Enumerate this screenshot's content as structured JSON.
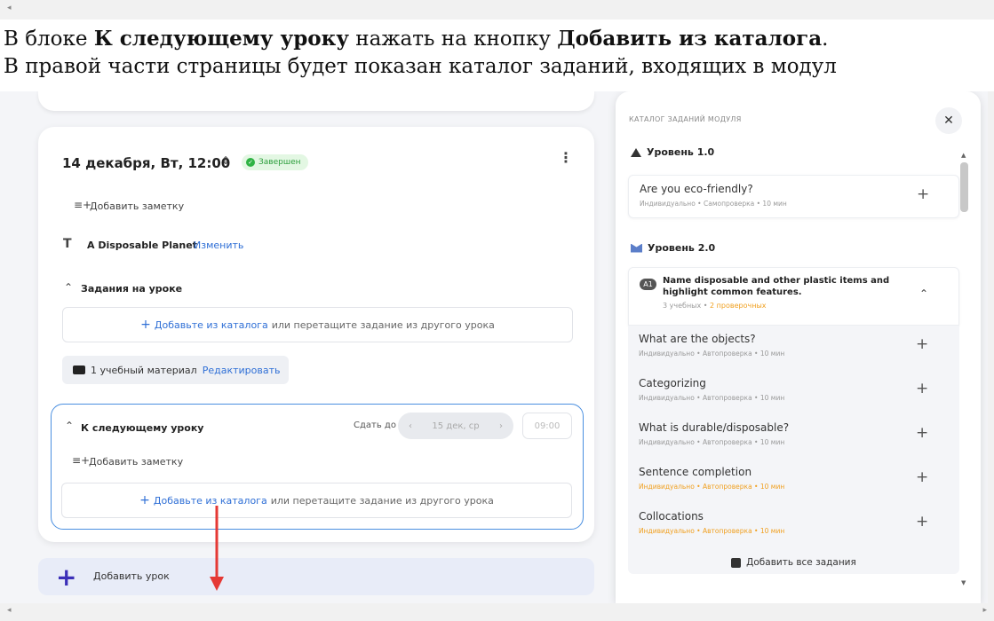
{
  "instructions": {
    "line1_a": "В блоке ",
    "line1_b": "К следующему уроку",
    "line1_c": " нажать на кнопку ",
    "line1_d": "Добавить из каталога",
    "line1_e": ".",
    "line2": "В правой части страницы будет показан каталог заданий, входящих в модул"
  },
  "lesson": {
    "date": "14 декабря, Вт, 12:00",
    "status": "Завершен",
    "add_note": "Добавить заметку",
    "topic_title": "A Disposable Planet",
    "topic_edit": "Изменить",
    "tasks_header": "Задания на уроке",
    "drop_link": "Добавьте из каталога",
    "drop_rest": "или перетащите задание из другого урока",
    "material": "1 учебный материал",
    "material_edit": "Редактировать"
  },
  "next_lesson": {
    "header": "К следующему уроку",
    "due_label": "Сдать до",
    "due_date": "15 дек, ср",
    "due_time": "09:00",
    "add_note": "Добавить заметку",
    "drop_link": "Добавьте из каталога",
    "drop_rest": "или перетащите задание из другого урока"
  },
  "add_lesson": {
    "label": "Добавить урок"
  },
  "catalog": {
    "title": "КАТАЛОГ ЗАДАНИЙ МОДУЛЯ",
    "level1": "Уровень 1.0",
    "level1_task": {
      "name": "Are you eco-friendly?",
      "meta": "Индивидуально • Самопроверка • 10 мин"
    },
    "level2": "Уровень 2.0",
    "group": {
      "badge": "A1",
      "title_line1": "Name disposable and other plastic items and",
      "title_line2": "highlight common features.",
      "count_a": "3 учебных •",
      "count_b": "2 проверочных"
    },
    "tasks": [
      {
        "name": "What are the objects?",
        "meta": "Индивидуально • Автопроверка • 10 мин"
      },
      {
        "name": "Categorizing",
        "meta": "Индивидуально • Автопроверка • 10 мин"
      },
      {
        "name": "What is durable/disposable?",
        "meta": "Индивидуально • Автопроверка • 10 мин"
      },
      {
        "name": "Sentence completion",
        "meta": "Индивидуально • Автопроверка • 10 мин"
      },
      {
        "name": "Collocations",
        "meta": "Индивидуально • Автопроверка • 10 мин"
      }
    ],
    "add_all": "Добавить все задания"
  },
  "colors": {
    "accent": "#2f6fd6",
    "highlight": "#4a8fe0",
    "success": "#2fb344",
    "arrow": "#e53935",
    "warning": "#f0a020"
  }
}
